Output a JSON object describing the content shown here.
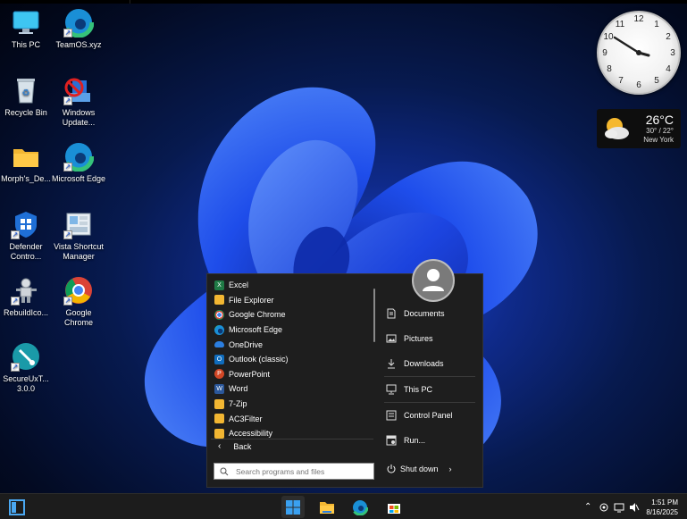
{
  "desktop": {
    "icons": [
      {
        "label": "This PC"
      },
      {
        "label": "TeamOS.xyz"
      },
      {
        "label": "Recycle Bin"
      },
      {
        "label": "Windows Update..."
      },
      {
        "label": "Morph's_De..."
      },
      {
        "label": "Microsoft Edge"
      },
      {
        "label": "Defender Contro..."
      },
      {
        "label": "Vista Shortcut Manager"
      },
      {
        "label": "RebuildIco..."
      },
      {
        "label": "Google Chrome"
      },
      {
        "label": "SecureUxT... 3.0.0"
      }
    ]
  },
  "clock_widget": {
    "numbers": [
      "12",
      "1",
      "2",
      "3",
      "4",
      "5",
      "6",
      "7",
      "8",
      "9",
      "10",
      "11"
    ],
    "time": "1:51"
  },
  "weather": {
    "temp": "26°C",
    "hilo": "30° / 22°",
    "city": "New York"
  },
  "start_menu": {
    "apps": [
      "Excel",
      "File Explorer",
      "Google Chrome",
      "Microsoft Edge",
      "OneDrive",
      "Outlook (classic)",
      "PowerPoint",
      "Word",
      "7-Zip",
      "AC3Filter",
      "Accessibility"
    ],
    "back_label": "Back",
    "right_items": [
      "Documents",
      "Pictures",
      "Downloads",
      "This PC",
      "Control Panel",
      "Run..."
    ],
    "search_placeholder": "Search programs and files",
    "shutdown_label": "Shut down"
  },
  "taskbar": {
    "time": "1:51 PM",
    "date": "8/16/2025"
  },
  "colors": {
    "accent": "#1a73e8",
    "menu_bg": "#1e1e1e",
    "taskbar_bg": "#1c1c1c"
  }
}
